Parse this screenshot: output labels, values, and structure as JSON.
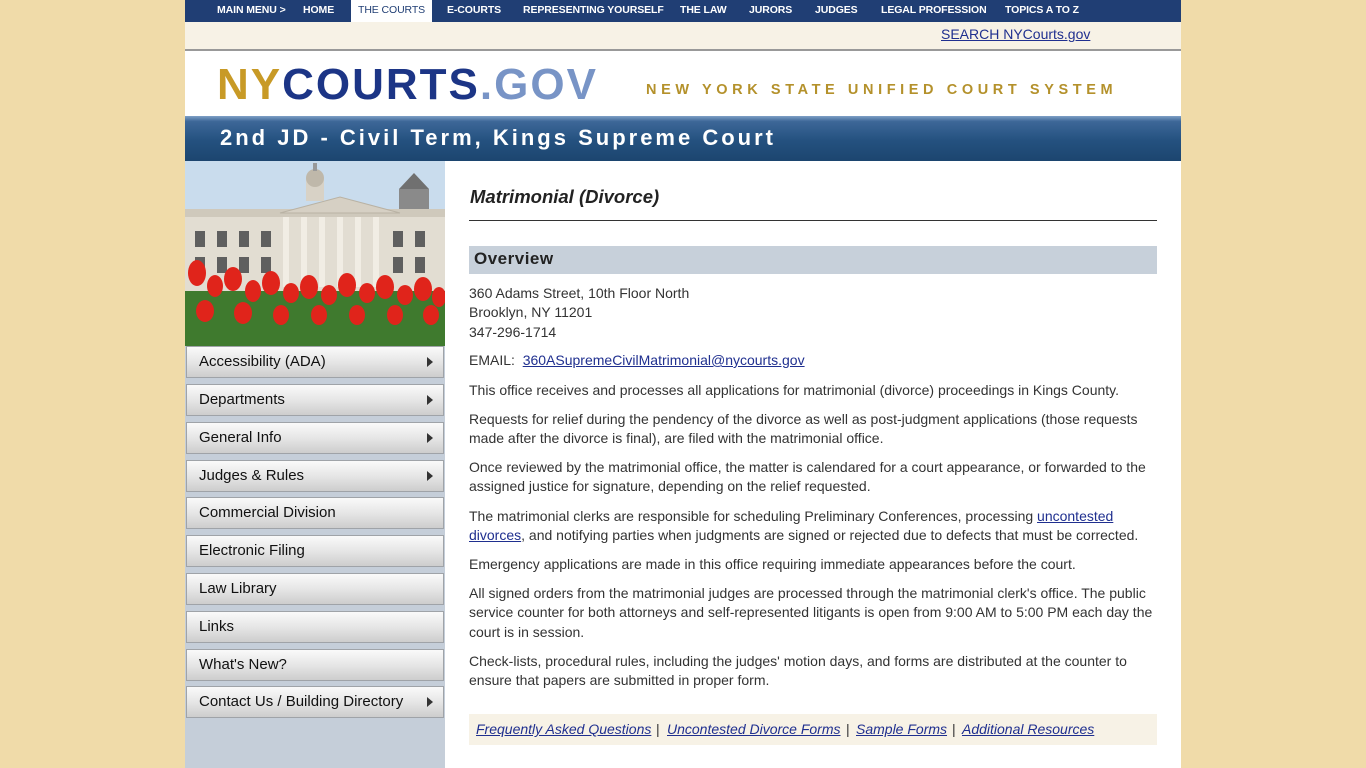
{
  "nav": {
    "items": [
      "MAIN MENU >",
      "HOME",
      "THE COURTS",
      "E-COURTS",
      "REPRESENTING YOURSELF",
      "THE LAW",
      "JURORS",
      "JUDGES",
      "LEGAL PROFESSION",
      "TOPICS A TO Z"
    ],
    "active": "THE COURTS"
  },
  "search": {
    "label": "SEARCH NYCourts.gov"
  },
  "header": {
    "logo_ny": "NY",
    "logo_courts": "COURTS",
    "logo_gov": ".GOV",
    "tagline": "NEW YORK STATE UNIFIED COURT SYSTEM"
  },
  "banner": {
    "title": "2nd JD - Civil Term, Kings Supreme Court"
  },
  "sidebar": {
    "items": [
      {
        "label": "Accessibility (ADA)",
        "has_submenu": true
      },
      {
        "label": "Departments",
        "has_submenu": true
      },
      {
        "label": "General Info",
        "has_submenu": true
      },
      {
        "label": "Judges & Rules",
        "has_submenu": true
      },
      {
        "label": "Commercial Division",
        "has_submenu": false
      },
      {
        "label": "Electronic Filing",
        "has_submenu": false
      },
      {
        "label": "Law Library",
        "has_submenu": false
      },
      {
        "label": "Links",
        "has_submenu": false
      },
      {
        "label": "What's New?",
        "has_submenu": false
      },
      {
        "label": "Contact Us / Building Directory",
        "has_submenu": true
      }
    ]
  },
  "main": {
    "title": "Matrimonial (Divorce)",
    "section": "Overview",
    "address1": "360 Adams Street, 10th Floor North",
    "address2": "Brooklyn, NY 11201",
    "phone": "347-296-1714",
    "email_label": "EMAIL:",
    "email": "360ASupremeCivilMatrimonial@nycourts.gov",
    "p1": "This office receives and processes all applications for matrimonial (divorce) proceedings in Kings County.",
    "p2": "Requests for relief during the pendency of the divorce as well as post-judgment applications (those requests made after the divorce is final), are filed with the matrimonial office.",
    "p3": "Once reviewed by the matrimonial office, the matter is calendared for a court appearance, or forwarded to the assigned justice for signature, depending on the relief requested.",
    "p4_before": "The matrimonial clerks are responsible for scheduling Preliminary Conferences, processing ",
    "p4_link": "uncontested divorces",
    "p4_after": ", and notifying parties when judgments are signed or rejected due to defects that must be corrected.",
    "p5": "Emergency applications are made in this office requiring immediate appearances before the court.",
    "p6": "All signed orders from the matrimonial judges are processed through the matrimonial clerk's office. The public service counter for both attorneys and self-represented litigants is open from 9:00 AM to 5:00 PM each day the court is in session.",
    "p7": "Check-lists, procedural rules, including the judges' motion days, and forms are distributed at the counter to ensure that papers are submitted in proper form."
  },
  "footer_links": {
    "items": [
      "Frequently Asked Questions",
      "Uncontested Divorce Forms",
      "Sample Forms",
      "Additional Resources"
    ],
    "separator": "|"
  },
  "colors": {
    "nav_bg": "#203e74",
    "banner_bg": "#24517f",
    "logo_gold": "#c89a26",
    "logo_navy": "#1c3586",
    "logo_light": "#7894c6",
    "page_bg": "#f0dba9",
    "link": "#1f2f8f"
  }
}
